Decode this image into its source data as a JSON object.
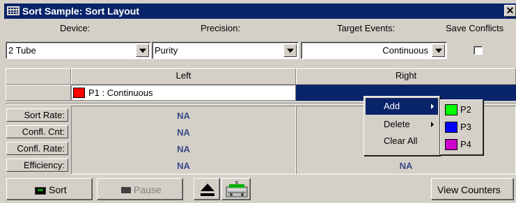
{
  "window": {
    "title": "Sort Sample: Sort Layout",
    "close_glyph": "✕"
  },
  "fields": {
    "device_label": "Device:",
    "precision_label": "Precision:",
    "target_events_label": "Target Events:",
    "save_conflicts_label": "Save Conflicts",
    "device_value": "2 Tube",
    "precision_value": "Purity",
    "target_events_value": "Continuous",
    "save_conflicts_checked": false
  },
  "layout_table": {
    "left_header": "Left",
    "right_header": "Right",
    "left_gate": {
      "label": "P1 : Continuous",
      "color": "#ff0000"
    }
  },
  "stats": {
    "rows": [
      {
        "label": "Sort Rate:",
        "left": "NA",
        "right": ""
      },
      {
        "label": "Confl. Cnt:",
        "left": "NA",
        "right": ""
      },
      {
        "label": "Confl. Rate:",
        "left": "NA",
        "right": ""
      },
      {
        "label": "Efficiency:",
        "left": "NA",
        "right": "NA"
      }
    ]
  },
  "toolbar": {
    "sort_label": "Sort",
    "pause_label": "Pause",
    "view_counters_label": "View Counters"
  },
  "context_menu": {
    "items": [
      {
        "label": "Add",
        "has_submenu": true
      },
      {
        "label": "Delete",
        "has_submenu": true
      },
      {
        "label": "Clear All",
        "has_submenu": false
      }
    ]
  },
  "submenu": {
    "items": [
      {
        "label": "P2",
        "color": "#00ff00"
      },
      {
        "label": "P3",
        "color": "#0000ff"
      },
      {
        "label": "P4",
        "color": "#cc00cc"
      }
    ]
  },
  "colors": {
    "titlebar": "#0a246a",
    "selection": "#0a246a",
    "na_text": "#3a4a8a"
  }
}
